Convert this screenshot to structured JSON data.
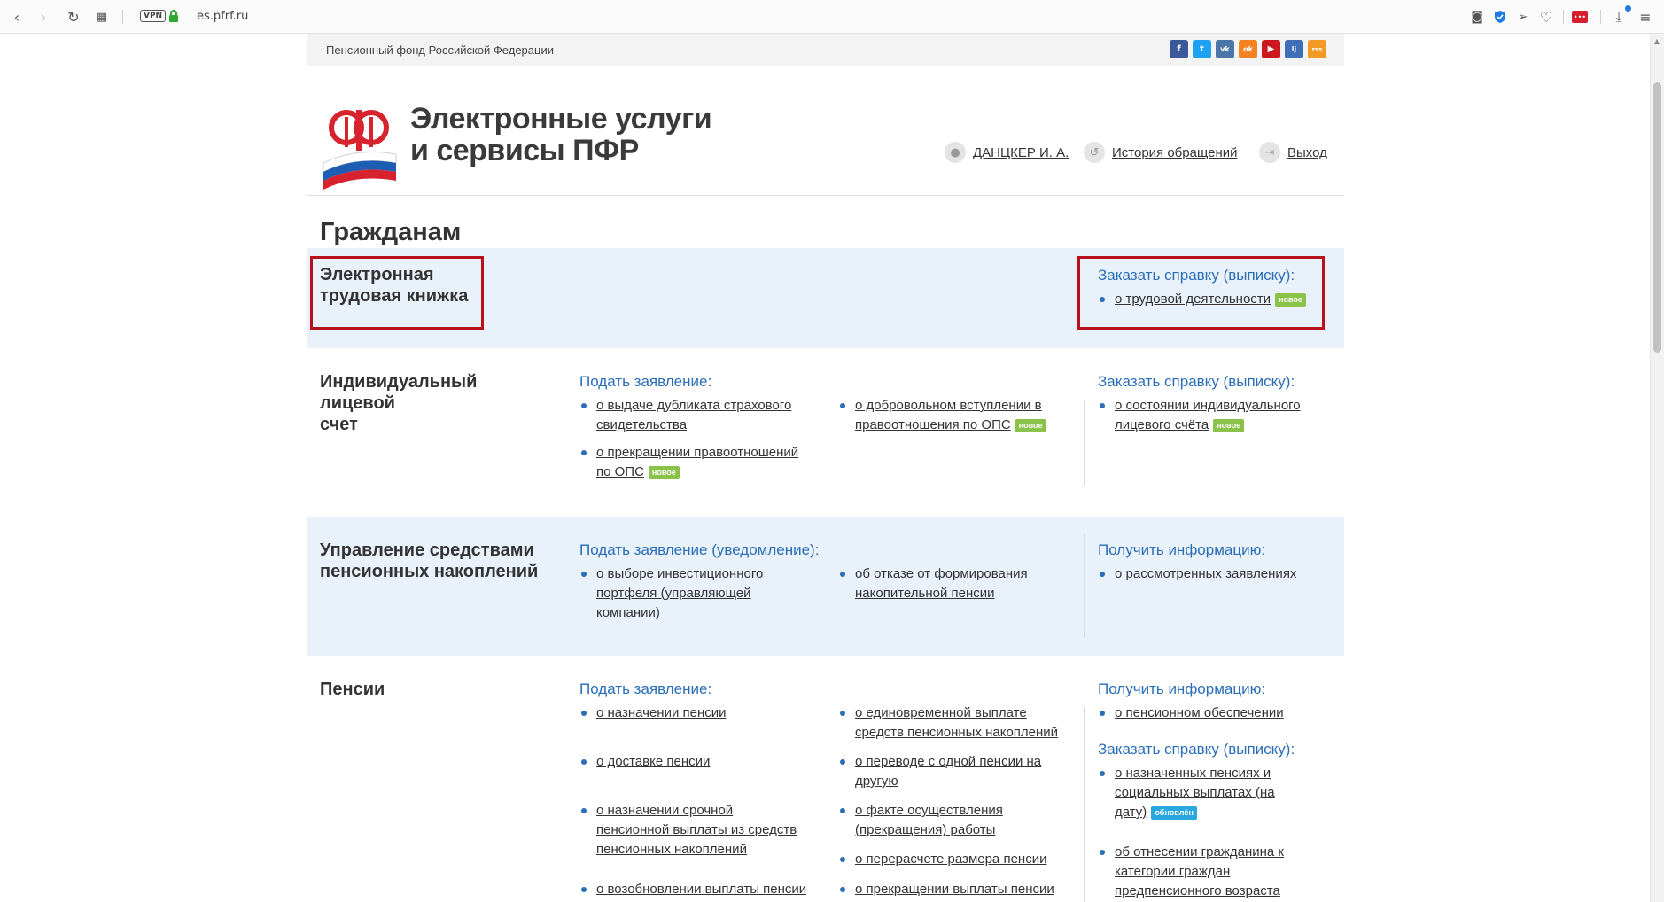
{
  "browser": {
    "vpn_label": "VPN",
    "url": "es.pfrf.ru"
  },
  "site": {
    "fund_name": "Пенсионный фонд Российской Федерации",
    "title_line1": "Электронные услуги",
    "title_line2": "и сервисы ПФР",
    "user_name": "ДАНЦКЕР И. А.",
    "history_label": "История обращений",
    "logout_label": "Выход",
    "social": [
      "f",
      "t",
      "vk",
      "ok",
      "▶",
      "lj",
      "rss"
    ]
  },
  "page_title": "Гражданам",
  "sections": {
    "etk": {
      "title_line1": "Электронная",
      "title_line2": "трудовая книжка",
      "order_head": "Заказать справку (выписку):",
      "order_item": "о трудовой деятельности",
      "order_badge": "новое"
    },
    "ils": {
      "title_line1": "Индивидуальный лицевой",
      "title_line2": "счет",
      "apply_head": "Подать заявление:",
      "apply_1a": "о выдаче дубликата страхового",
      "apply_1b": "свидетельства",
      "apply_2a": "о прекращении правоотношений",
      "apply_2b": "по ОПС",
      "apply_2_badge": "новое",
      "apply_3a": "о добровольном вступлении в",
      "apply_3b": "правоотношения по ОПС",
      "apply_3_badge": "новое",
      "order_head": "Заказать справку (выписку):",
      "order_1a": "о состоянии индивидуального",
      "order_1b": "лицевого счёта",
      "order_1_badge": "новое"
    },
    "savings": {
      "title_line1": "Управление средствами",
      "title_line2": "пенсионных накоплений",
      "apply_head": "Подать заявление (уведомление):",
      "apply_1a": "о выборе инвестиционного",
      "apply_1b": "портфеля (управляющей",
      "apply_1c": "компании)",
      "apply_2a": "об отказе от формирования",
      "apply_2b": "накопительной пенсии",
      "info_head": "Получить информацию:",
      "info_1": "о рассмотренных заявлениях"
    },
    "pensions": {
      "title": "Пенсии",
      "apply_head": "Подать заявление:",
      "c1_1": "о назначении пенсии",
      "c1_2": "о доставке пенсии",
      "c1_3a": "о назначении срочной",
      "c1_3b": "пенсионной выплаты из средств",
      "c1_3c": "пенсионных накоплений",
      "c1_4": "о возобновлении выплаты пенсии",
      "c2_1a": "о единовременной выплате",
      "c2_1b": "средств пенсионных накоплений",
      "c2_2a": "о переводе с одной пенсии на",
      "c2_2b": "другую",
      "c2_3a": "о факте осуществления",
      "c2_3b": "(прекращения) работы",
      "c2_4": "о перерасчете размера пенсии",
      "c2_5": "о прекращении выплаты пенсии",
      "info_head": "Получить информацию:",
      "info_1": "о пенсионном обеспечении",
      "order_head": "Заказать справку (выписку):",
      "order_1a": "о назначенных пенсиях и",
      "order_1b": "социальных выплатах (на",
      "order_1c": "дату)",
      "order_1_badge": "обновлён",
      "order_2a": "об отнесении гражданина к",
      "order_2b": "категории граждан",
      "order_2c": "предпенсионного возраста"
    }
  },
  "colors": {
    "accent_blue": "#2a6eb8",
    "section_bg": "#e9f2fb",
    "highlight_red": "#b8111b",
    "badge_new": "#8bc34a",
    "badge_updated": "#29a8e0"
  }
}
